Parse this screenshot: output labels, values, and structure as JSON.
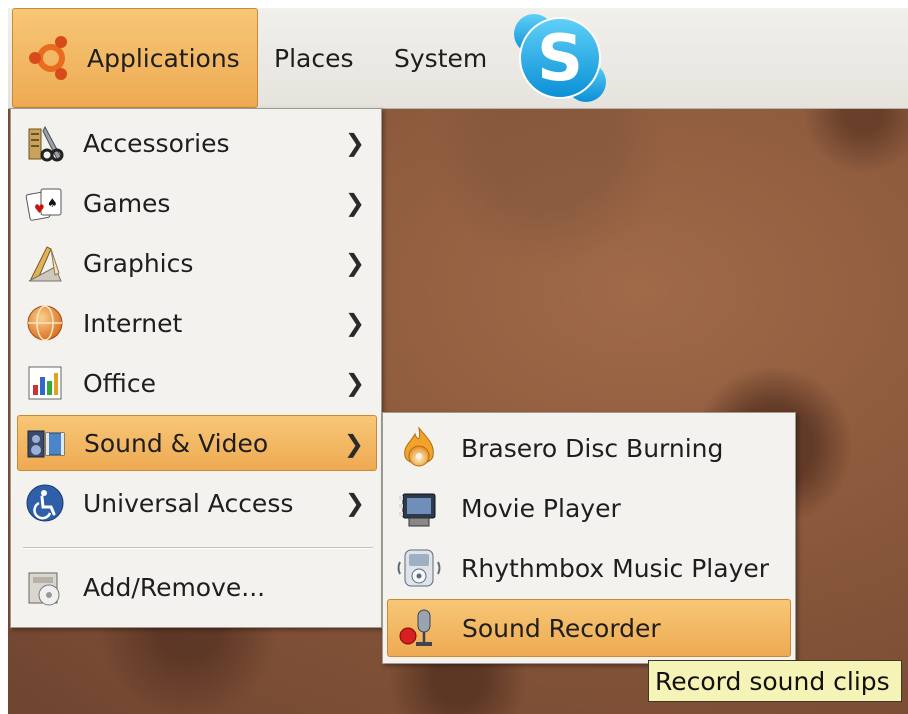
{
  "panel": {
    "applications_label": "Applications",
    "places_label": "Places",
    "system_label": "System"
  },
  "menu": {
    "items": [
      {
        "label": "Accessories",
        "icon": "accessories-icon",
        "has_submenu": true
      },
      {
        "label": "Games",
        "icon": "games-icon",
        "has_submenu": true
      },
      {
        "label": "Graphics",
        "icon": "graphics-icon",
        "has_submenu": true
      },
      {
        "label": "Internet",
        "icon": "internet-icon",
        "has_submenu": true
      },
      {
        "label": "Office",
        "icon": "office-icon",
        "has_submenu": true
      },
      {
        "label": "Sound & Video",
        "icon": "sound-video-icon",
        "has_submenu": true,
        "active": true
      },
      {
        "label": "Universal Access",
        "icon": "universal-access-icon",
        "has_submenu": true
      }
    ],
    "add_remove_label": "Add/Remove...",
    "arrow": "❯"
  },
  "submenu": {
    "items": [
      {
        "label": "Brasero Disc Burning",
        "icon": "brasero-icon"
      },
      {
        "label": "Movie Player",
        "icon": "movie-player-icon"
      },
      {
        "label": "Rhythmbox Music Player",
        "icon": "rhythmbox-icon"
      },
      {
        "label": "Sound Recorder",
        "icon": "sound-recorder-icon",
        "active": true
      }
    ]
  },
  "tooltip": {
    "text": "Record sound clips"
  },
  "colors": {
    "highlight": "#eeaa52",
    "menu_bg": "#f4f2ef",
    "panel_bg": "#e6e3dd",
    "tooltip_bg": "#f5f3b5"
  }
}
